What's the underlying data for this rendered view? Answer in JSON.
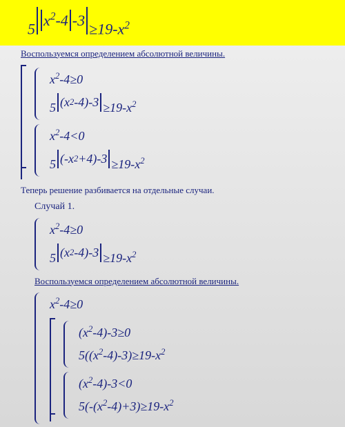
{
  "main_equation": "5||x²−4|−3| ≥ 19−x²",
  "hint1": "Воспользуемся определением абсолютной величины.",
  "system1": {
    "case_a": {
      "cond": "x²−4 ≥ 0",
      "ineq": "5|(x²−4)−3| ≥ 19−x²"
    },
    "case_b": {
      "cond": "x²−4 < 0",
      "ineq": "5|(−x²+4)−3| ≥ 19−x²"
    }
  },
  "split_text": "Теперь решение разбивается на отдельные случаи.",
  "case1_label": "Случай 1.",
  "case1": {
    "cond": "x²−4 ≥ 0",
    "ineq": "5|(x²−4)−3| ≥ 19−x²"
  },
  "hint2": "Воспользуемся определением абсолютной величины.",
  "system2": {
    "cond": "x²−4 ≥ 0",
    "sub_a": {
      "cond": "(x²−4)−3 ≥ 0",
      "ineq": "5((x²−4)−3) ≥ 19−x²"
    },
    "sub_b": {
      "cond": "(x²−4)−3 < 0",
      "ineq": "5(−(x²−4)+3) ≥ 19−x²"
    }
  }
}
